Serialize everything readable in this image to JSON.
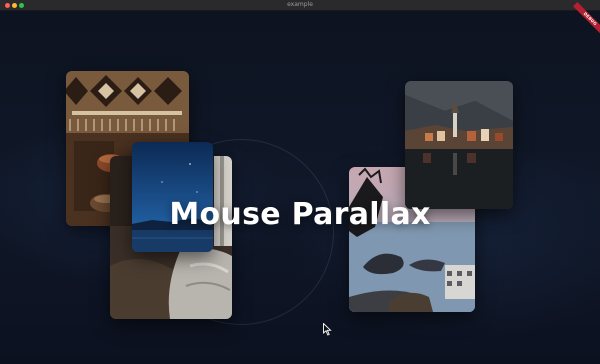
{
  "window": {
    "title": "example",
    "debug_badge": "DEBUG"
  },
  "hero": {
    "title": "Mouse Parallax"
  },
  "cards": [
    {
      "name": "rug-card",
      "subject": "woven rug and copper kettle"
    },
    {
      "name": "sofa-card",
      "subject": "sofa with grey blanket"
    },
    {
      "name": "night-lake-card",
      "subject": "starry night over lake"
    },
    {
      "name": "coast-card",
      "subject": "rocky coastline with houses"
    },
    {
      "name": "village-card",
      "subject": "lakeside alpine village"
    }
  ],
  "colors": {
    "background": "#0e1422",
    "title_text": "#ffffff",
    "debug_ribbon": "#b3202f"
  },
  "icons": {
    "cursor": "arrow-pointer-icon"
  }
}
